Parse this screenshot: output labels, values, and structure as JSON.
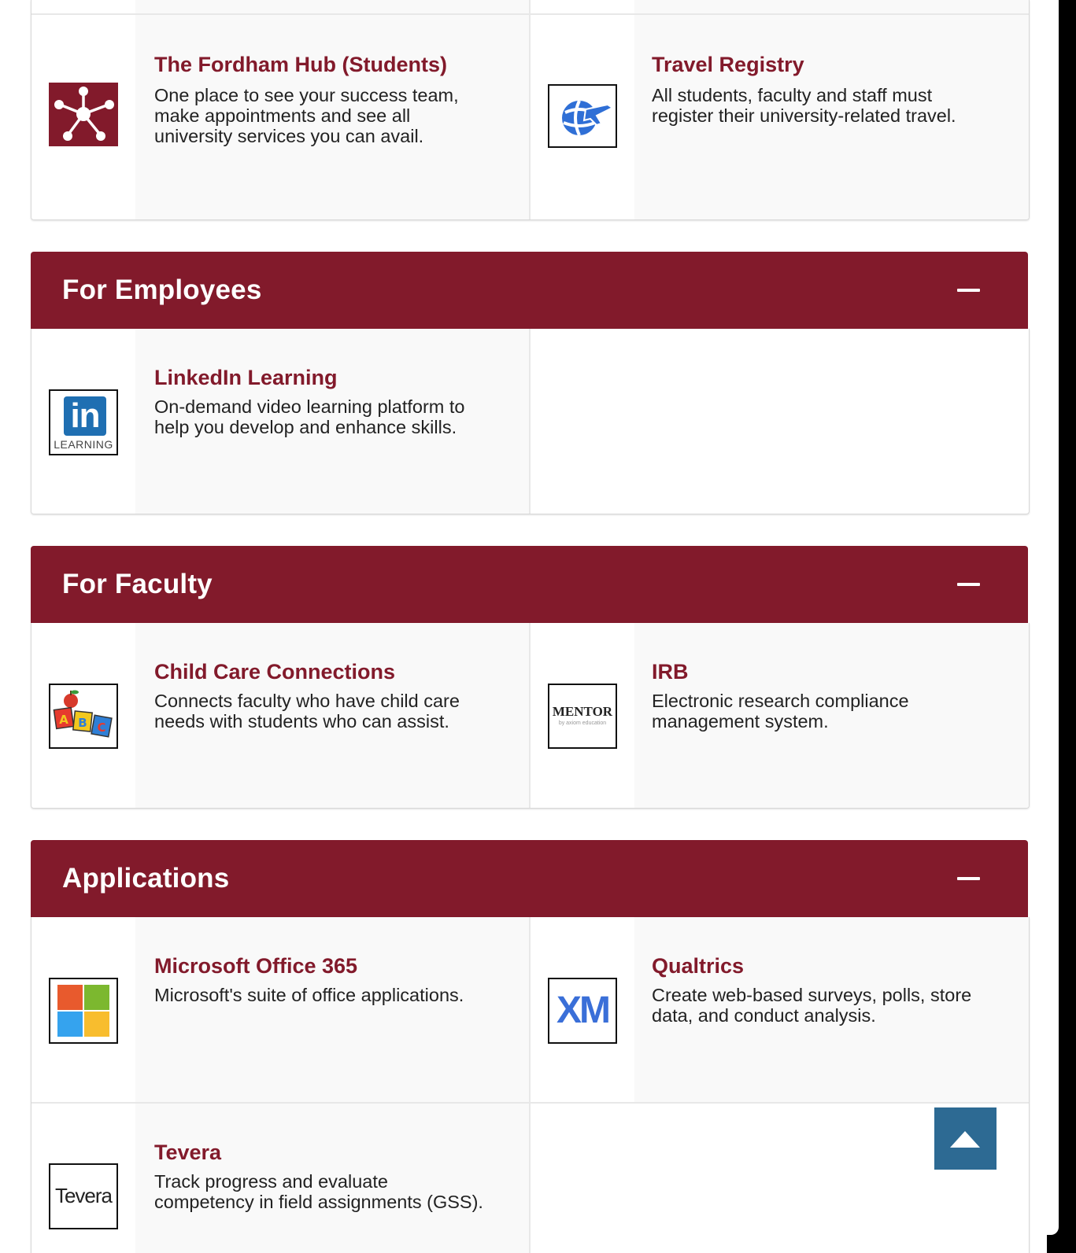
{
  "students_section": {
    "cards": [
      {
        "title": "The Fordham Hub (Students)",
        "description": "One place to see your success team, make appointments and see all university services you can avail.",
        "icon": "network-hub-icon"
      },
      {
        "title": "Travel Registry",
        "description": "All students, faculty and staff must register their university-related travel.",
        "icon": "globe-airplane-icon"
      }
    ]
  },
  "employees_section": {
    "title": "For Employees",
    "cards": [
      {
        "title": "LinkedIn Learning",
        "description": "On-demand video learning platform to help you develop and enhance skills.",
        "icon": "linkedin-learning-logo",
        "logo_text": "in",
        "logo_caption": "LEARNING"
      }
    ]
  },
  "faculty_section": {
    "title": "For Faculty",
    "cards": [
      {
        "title": "Child Care Connections",
        "description": "Connects faculty who have child care needs with students who can assist.",
        "icon": "abc-blocks-icon",
        "logo_letters": [
          "A",
          "B",
          "C"
        ]
      },
      {
        "title": "IRB",
        "description": "Electronic research compliance management system.",
        "icon": "mentor-logo",
        "logo_text": "MENTOR",
        "logo_sub": "by axiom education"
      }
    ]
  },
  "applications_section": {
    "title": "Applications",
    "cards": [
      {
        "title": "Microsoft Office 365",
        "description": "Microsoft's suite of office applications.",
        "icon": "microsoft-logo"
      },
      {
        "title": "Qualtrics",
        "description": "Create web-based surveys, polls, store data, and conduct analysis.",
        "icon": "qualtrics-xm-logo",
        "logo_text": "XM"
      },
      {
        "title": "Tevera",
        "description": "Track progress and evaluate competency in field assignments (GSS).",
        "icon": "tevera-logo",
        "logo_text": "Tevera"
      }
    ]
  },
  "back_to_top": {
    "icon": "arrow-up-icon"
  },
  "colors": {
    "brand": "#821a2b",
    "back_to_top": "#2d6a93",
    "card_text_bg": "#f9f9f9"
  }
}
